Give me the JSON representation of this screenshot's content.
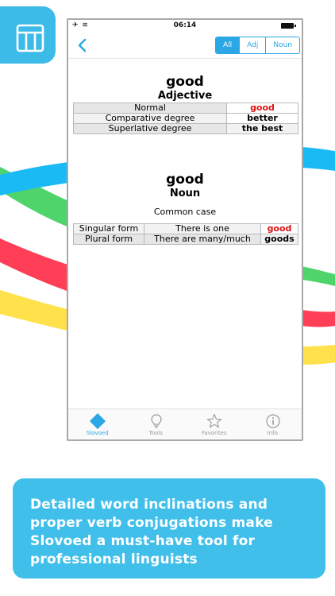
{
  "statusbar": {
    "time": "06:14"
  },
  "nav": {
    "filters": [
      "All",
      "Adj",
      "Noun"
    ],
    "active_filter": "All"
  },
  "adjective": {
    "word": "good",
    "pos": "Adjective",
    "rows": [
      {
        "label": "Normal",
        "value": "good",
        "highlight": true
      },
      {
        "label": "Comparative degree",
        "value": "better",
        "highlight": false
      },
      {
        "label": "Superlative degree",
        "value": "the best",
        "highlight": false
      }
    ]
  },
  "noun": {
    "word": "good",
    "pos": "Noun",
    "case": "Common case",
    "rows": [
      {
        "form": "Singular form",
        "desc": "There is one",
        "value": "good",
        "highlight": true
      },
      {
        "form": "Plural form",
        "desc": "There are many/much",
        "value": "goods",
        "highlight": false
      }
    ]
  },
  "tabbar": {
    "tabs": [
      {
        "label": "Slovoed",
        "icon": "slovoed-diamond-icon",
        "active": true
      },
      {
        "label": "Tools",
        "icon": "lightbulb-icon",
        "active": false
      },
      {
        "label": "Favorites",
        "icon": "star-icon",
        "active": false
      },
      {
        "label": "Info",
        "icon": "info-icon",
        "active": false
      }
    ]
  },
  "caption": "Detailed word inclinations and proper verb conjugations make Slovoed a must-have tool for professional linguists",
  "colors": {
    "accent": "#2aa7e4",
    "highlight_red": "#dd1111",
    "caption_bg": "#41bfeb"
  }
}
